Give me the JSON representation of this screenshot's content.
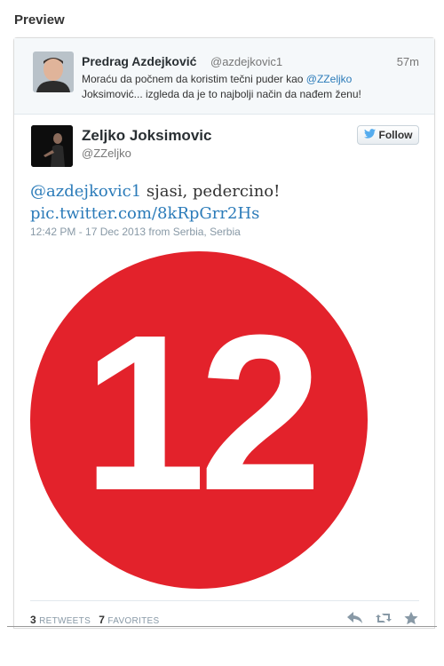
{
  "preview": {
    "title": "Preview"
  },
  "reply": {
    "name": "Predrag Azdejković",
    "handle": "@azdejkovic1",
    "time": "57m",
    "text_before": "Moraću da počnem da koristim tečni puder kao ",
    "mention": "@ZZeljko",
    "text_after": "Joksimović... izgleda da je to najbolji način da nađem ženu!"
  },
  "tweet": {
    "name": "Zeljko Joksimovic",
    "handle": "@ZZeljko",
    "follow_label": "Follow",
    "mention": "@azdejkovic1",
    "body": " sjasi, pedercino!",
    "link": "pic.twitter.com/8kRpGrr2Hs",
    "meta": "12:42 PM - 17 Dec 2013 from Serbia, Serbia",
    "media_number": "12",
    "retweets_count": "3",
    "retweets_label": "RETWEETS",
    "favorites_count": "7",
    "favorites_label": "FAVORITES"
  },
  "colors": {
    "link": "#2b7bb9",
    "logo_red": "#e3222b",
    "twitter_blue": "#55acee"
  },
  "icons": [
    "reply-icon",
    "retweet-icon",
    "favorite-icon",
    "twitter-bird-icon"
  ]
}
